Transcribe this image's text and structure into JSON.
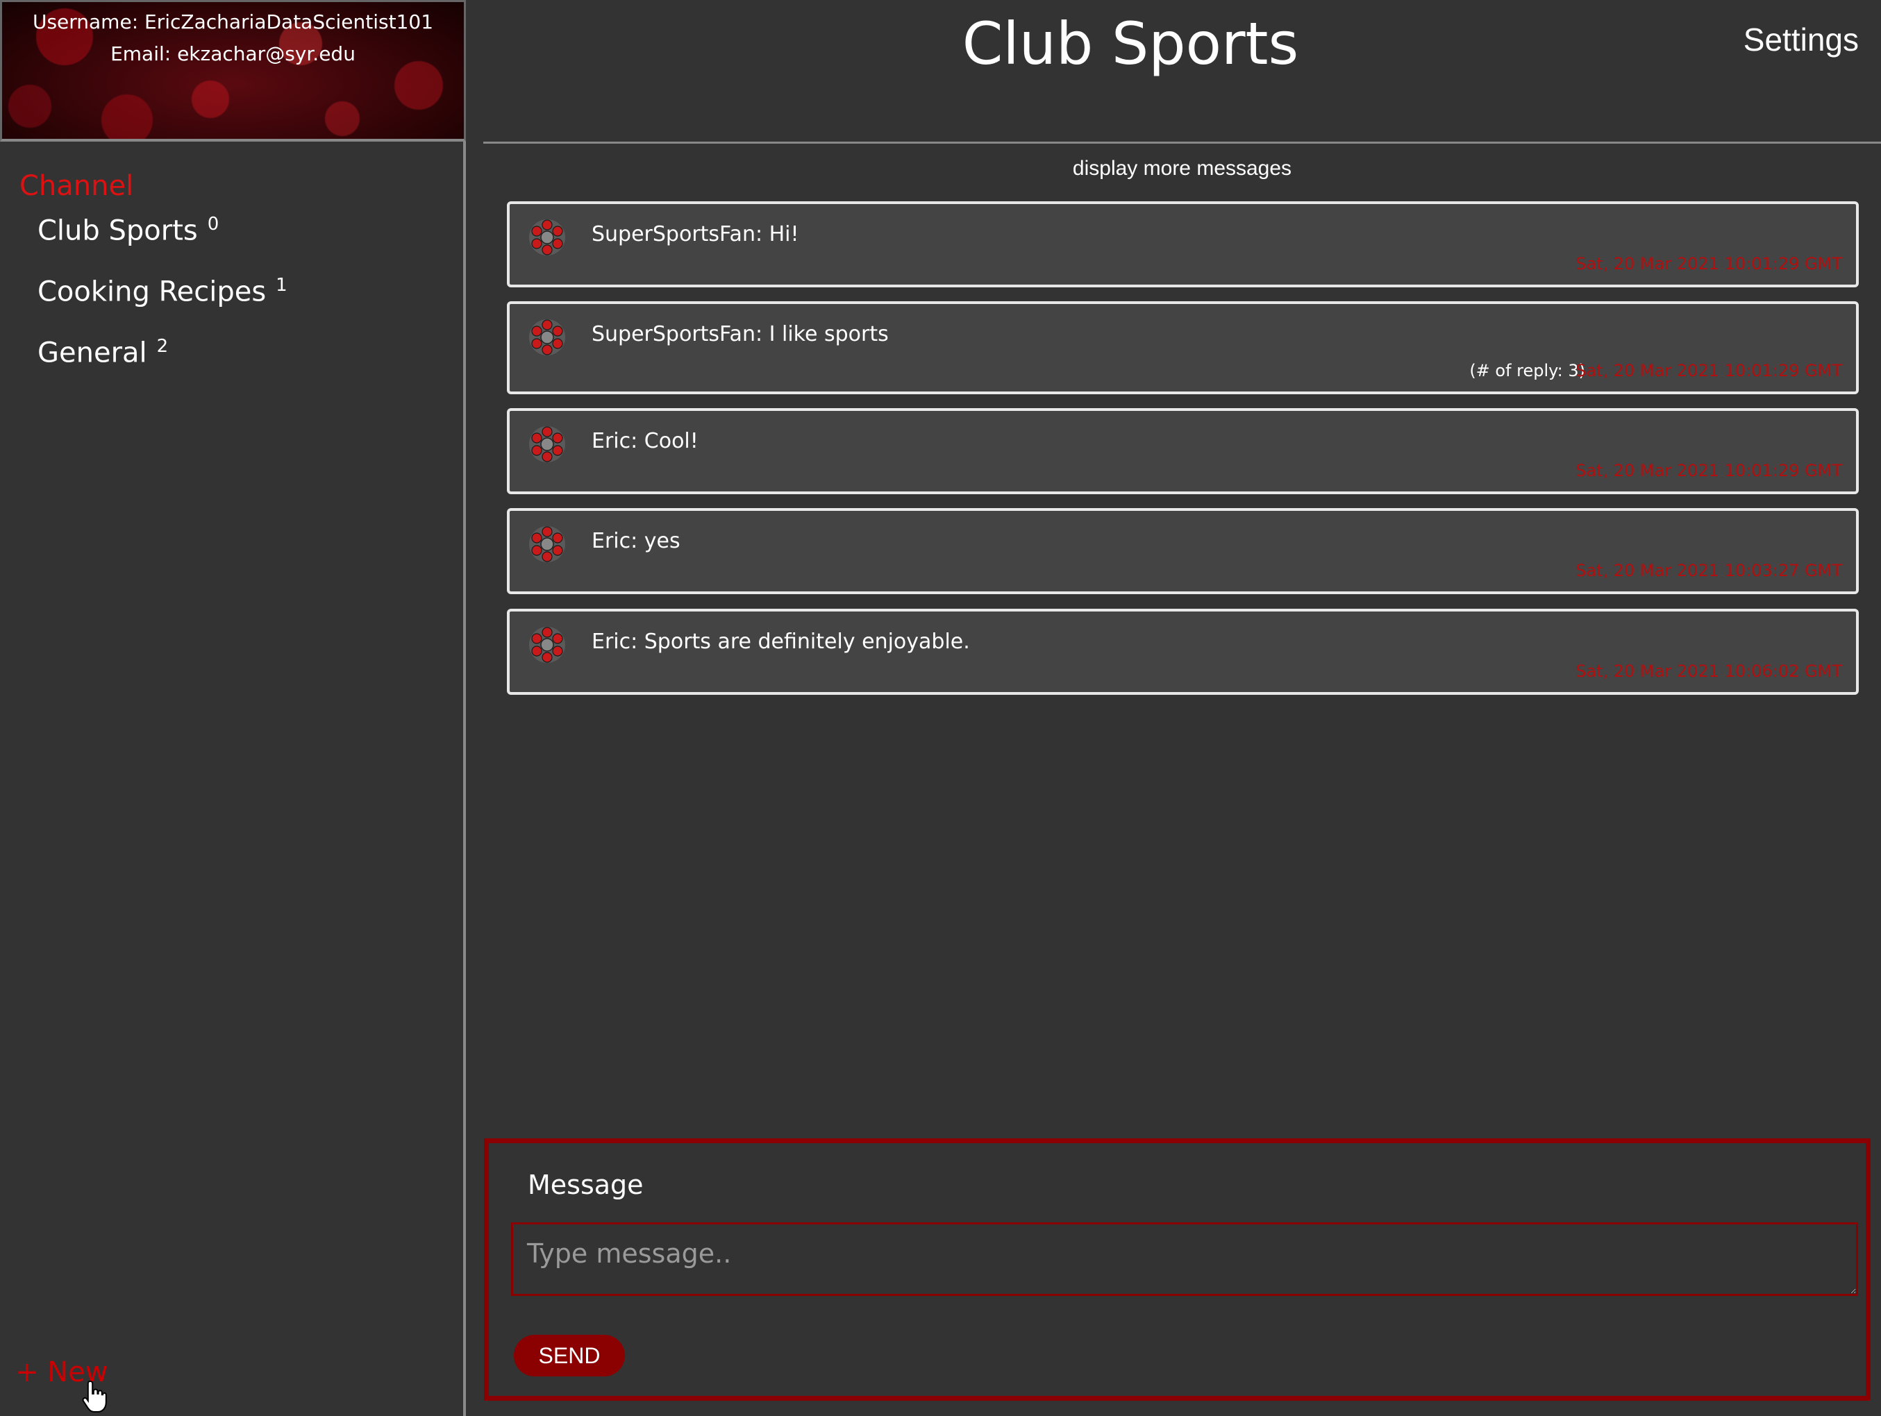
{
  "profile": {
    "username_line": "Username: EricZachariaDataScientist101",
    "email_line": "Email: ekzachar@syr.edu"
  },
  "sidebar": {
    "heading": "Channel",
    "channels": [
      {
        "name": "Club Sports",
        "count": "0"
      },
      {
        "name": "Cooking Recipes",
        "count": "1"
      },
      {
        "name": "General",
        "count": "2"
      }
    ],
    "new_label": "+ New"
  },
  "header": {
    "title": "Club Sports",
    "settings_label": "Settings"
  },
  "messages": {
    "more_label": "display more messages",
    "items": [
      {
        "text": "SuperSportsFan: Hi!",
        "time": "Sat, 20 Mar 2021 10:01:29 GMT",
        "replies": ""
      },
      {
        "text": "SuperSportsFan: I like sports",
        "time": "Sat, 20 Mar 2021 10:01:29 GMT",
        "replies": "(# of reply: 3)"
      },
      {
        "text": "Eric: Cool!",
        "time": "Sat, 20 Mar 2021 10:01:29 GMT",
        "replies": ""
      },
      {
        "text": "Eric: yes",
        "time": "Sat, 20 Mar 2021 10:03:27 GMT",
        "replies": ""
      },
      {
        "text": "Eric: Sports are definitely enjoyable.",
        "time": "Sat, 20 Mar 2021 10:06:02 GMT",
        "replies": ""
      }
    ]
  },
  "composer": {
    "label": "Message",
    "placeholder": "Type message..",
    "value": "",
    "send_label": "SEND"
  },
  "colors": {
    "background": "#333333",
    "accent": "#8b0000",
    "timestamp": "#b01010",
    "channel_heading": "#dd1111"
  },
  "icons": {
    "avatar": "avatar-icon",
    "cursor": "hand-pointer-icon"
  }
}
